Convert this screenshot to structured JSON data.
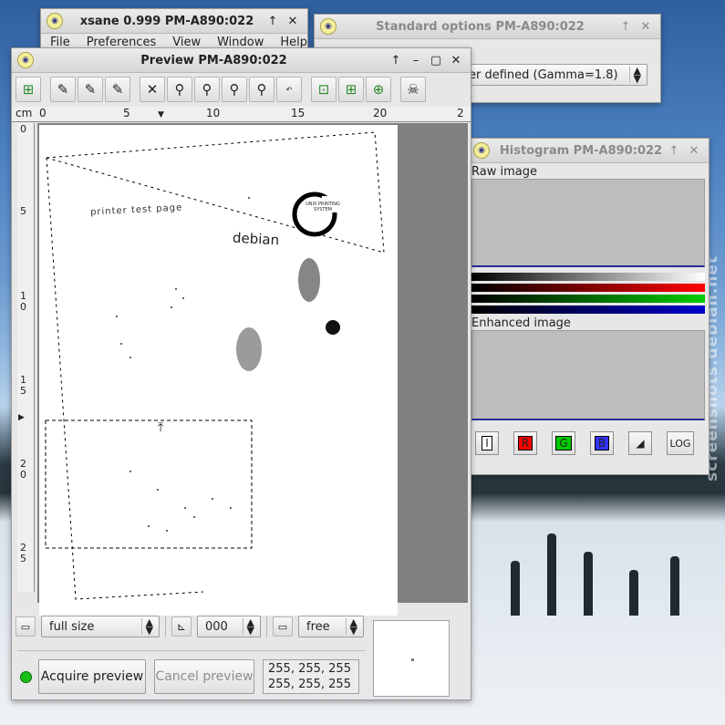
{
  "xsane": {
    "title": "xsane 0.999 PM-A890:022",
    "menu": [
      "File",
      "Preferences",
      "View",
      "Window",
      "Help"
    ]
  },
  "standard_options": {
    "title": "Standard options PM-A890:022",
    "gamma_value": "er defined (Gamma=1.8)"
  },
  "histogram": {
    "title": "Histogram PM-A890:022",
    "raw_label": "Raw image",
    "enhanced_label": "Enhanced image",
    "buttons": [
      "I",
      "R",
      "G",
      "B",
      "LOG"
    ],
    "colors": {
      "red": "#ff0000",
      "green": "#00c000",
      "blue": "#0000c0"
    }
  },
  "preview": {
    "title": "Preview PM-A890:022",
    "ruler_unit": "cm",
    "ruler_h": [
      "0",
      "5",
      "10",
      "15",
      "20",
      "2"
    ],
    "ruler_v": [
      "0",
      "5",
      "1\n0",
      "1\n5",
      "2\n0",
      "2\n5"
    ],
    "scan_text": "debian",
    "cups_text": "UNIX PRINTING SYSTEM",
    "small_text": "printer test page",
    "size_value": "full size",
    "rotation_value": "000",
    "aspect_value": "free",
    "acquire_label": "Acquire preview",
    "cancel_label": "Cancel preview",
    "rgb_line1": "255, 255, 255",
    "rgb_line2": "255, 255, 255",
    "status_color": "#18c018"
  },
  "watermark": "screenshots.debian.net"
}
